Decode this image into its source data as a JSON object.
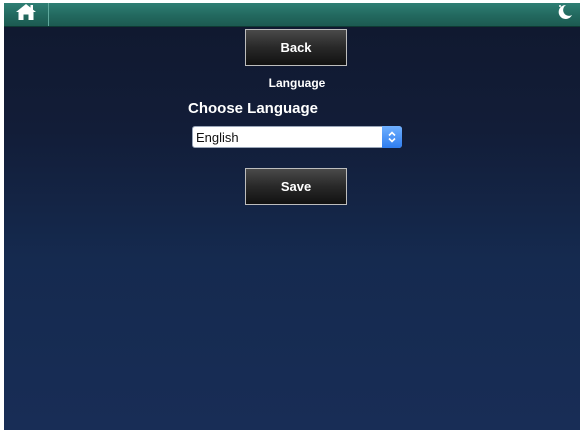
{
  "topbar": {
    "home_icon": "home-icon",
    "sleep_icon": "moon-icon"
  },
  "nav": {
    "back_label": "Back"
  },
  "page": {
    "title": "Language",
    "choose_label": "Choose Language"
  },
  "language_select": {
    "selected": "English"
  },
  "actions": {
    "save_label": "Save"
  },
  "colors": {
    "topbar": "#236a60",
    "background": "#152a4f",
    "select_arrow": "#2f7dee"
  }
}
